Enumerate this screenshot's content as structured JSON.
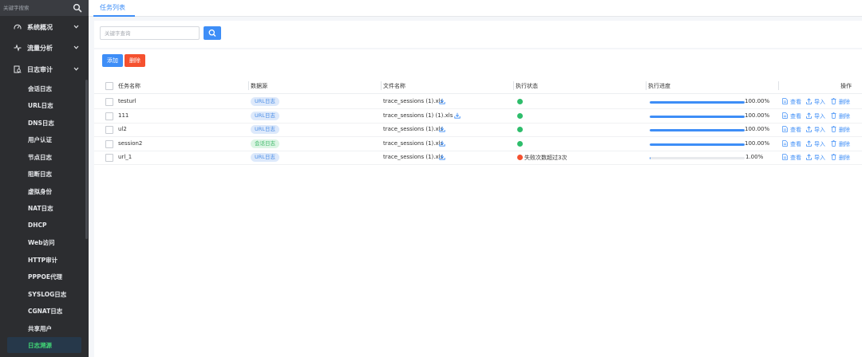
{
  "sidebar": {
    "search_placeholder": "关键字搜索",
    "groups": [
      {
        "label": "系统概况",
        "icon": "dashboard-icon"
      },
      {
        "label": "流量分析",
        "icon": "pulse-icon"
      },
      {
        "label": "日志审计",
        "icon": "log-audit-icon"
      }
    ],
    "items": [
      {
        "label": "会话日志"
      },
      {
        "label": "URL日志"
      },
      {
        "label": "DNS日志"
      },
      {
        "label": "用户认证"
      },
      {
        "label": "节点日志"
      },
      {
        "label": "阻断日志"
      },
      {
        "label": "虚拟身份"
      },
      {
        "label": "NAT日志"
      },
      {
        "label": "DHCP"
      },
      {
        "label": "Web访问"
      },
      {
        "label": "HTTP审计"
      },
      {
        "label": "PPPOE代理"
      },
      {
        "label": "SYSLOG日志"
      },
      {
        "label": "CGNAT日志"
      },
      {
        "label": "共享用户"
      },
      {
        "label": "日志溯源"
      }
    ],
    "active_index": 15,
    "active_color": "#41d476"
  },
  "tabs": [
    {
      "label": "任务列表"
    }
  ],
  "search": {
    "placeholder": "关键字查询"
  },
  "toolbar": {
    "add_label": "添加",
    "delete_label": "删除"
  },
  "table": {
    "headers": {
      "name": "任务名称",
      "source": "数据源",
      "file": "文件名称",
      "status": "执行状态",
      "progress": "执行进度",
      "actions": "操作"
    },
    "rows": [
      {
        "name": "testurl",
        "source": "URL日志",
        "source_type": "url",
        "file": "trace_sessions (1).xls",
        "status": "success",
        "status_text": "",
        "progress": 100,
        "progress_text": "100.00%"
      },
      {
        "name": "111",
        "source": "URL日志",
        "source_type": "url",
        "file": "trace_sessions (1) (1).xls",
        "status": "success",
        "status_text": "",
        "progress": 100,
        "progress_text": "100.00%"
      },
      {
        "name": "ul2",
        "source": "URL日志",
        "source_type": "url",
        "file": "trace_sessions (1).xls",
        "status": "success",
        "status_text": "",
        "progress": 100,
        "progress_text": "100.00%"
      },
      {
        "name": "session2",
        "source": "会话日志",
        "source_type": "session",
        "file": "trace_sessions (1).xls",
        "status": "success",
        "status_text": "",
        "progress": 100,
        "progress_text": "100.00%"
      },
      {
        "name": "url_1",
        "source": "URL日志",
        "source_type": "url",
        "file": "trace_sessions (1).xls",
        "status": "failed",
        "status_text": "失败次数超过3次",
        "progress": 1,
        "progress_text": "1.00%"
      }
    ],
    "actions": {
      "view": "查看",
      "import": "导入",
      "delete": "删除"
    }
  },
  "colors": {
    "primary": "#3e8ef7",
    "danger": "#f5512f",
    "success": "#2ebd6b",
    "failed": "#f5512f"
  }
}
